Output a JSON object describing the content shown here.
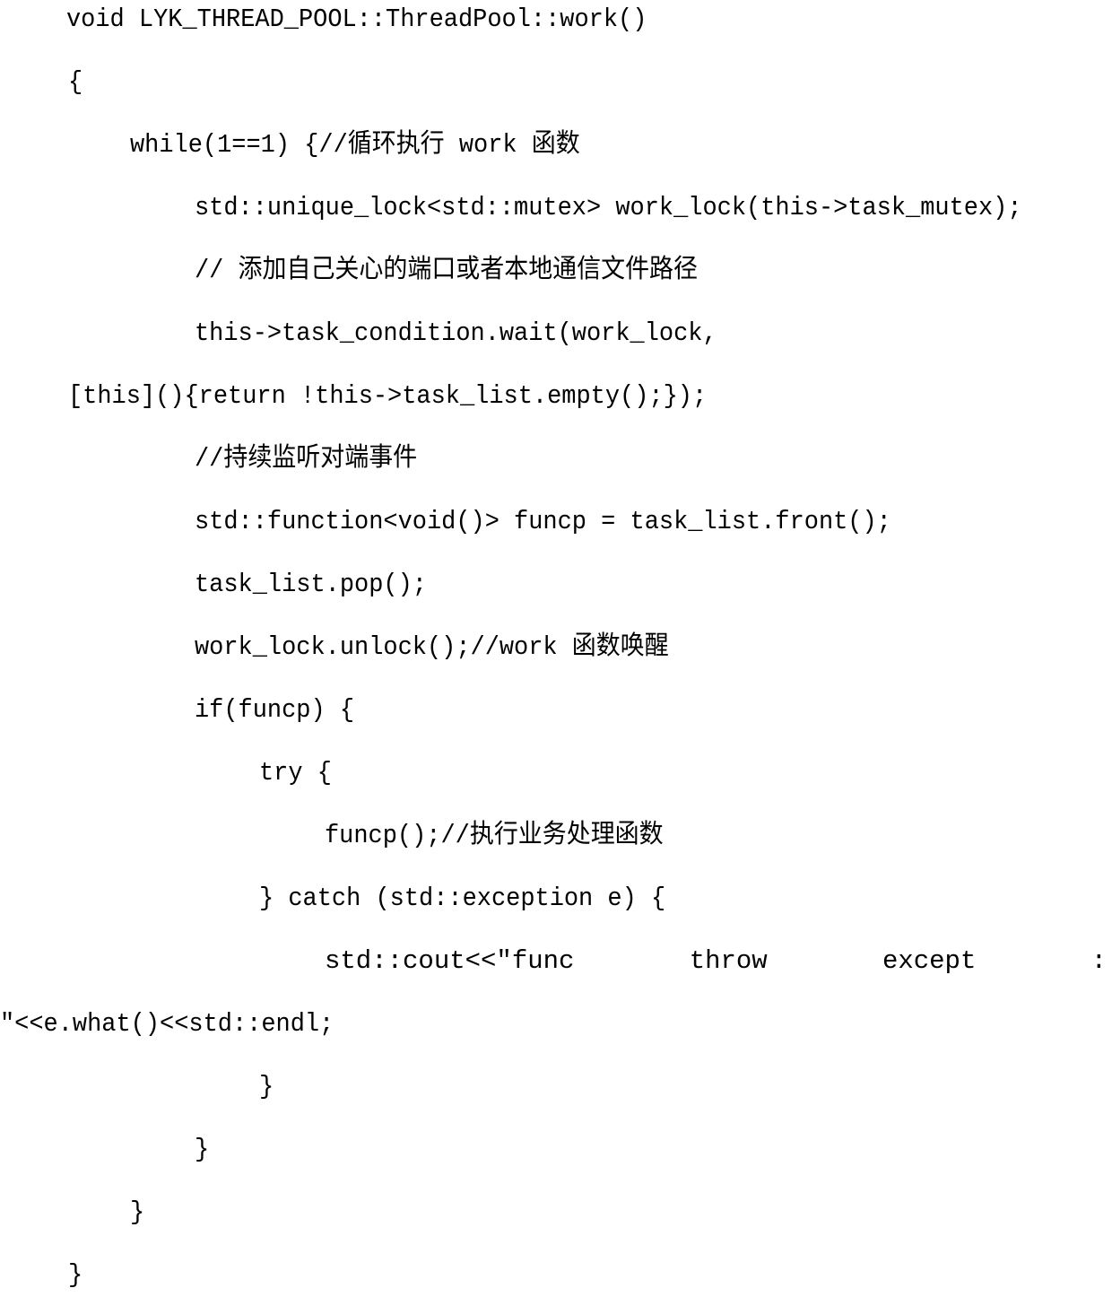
{
  "code": {
    "lines": [
      "void LYK_THREAD_POOL::ThreadPool::work()",
      "{",
      "while(1==1) {//循环执行 work 函数",
      "std::unique_lock<std::mutex> work_lock(this->task_mutex);",
      "// 添加自己关心的端口或者本地通信文件路径",
      "this->task_condition.wait(work_lock,",
      "[this](){return !this->task_list.empty();});",
      "//持续监听对端事件",
      "std::function<void()> funcp = task_list.front();",
      "task_list.pop();",
      "work_lock.unlock();//work 函数唤醒",
      "if(funcp) {",
      "try {",
      "funcp();//执行业务处理函数",
      "} catch (std::exception e) {",
      "\"<<e.what()<<std::endl;",
      "}",
      "}",
      "}",
      "}"
    ],
    "cout_line_parts": [
      "std::cout<<\"func",
      "throw",
      "except",
      ":"
    ]
  }
}
